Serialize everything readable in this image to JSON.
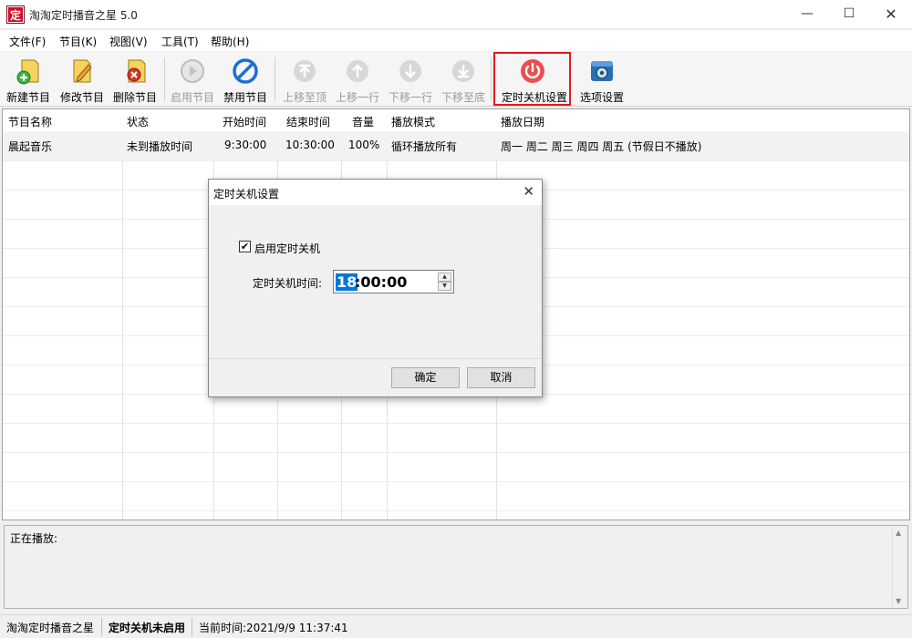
{
  "window": {
    "title": "淘淘定时播音之星 5.0",
    "app_icon_char": "定",
    "controls": {
      "minimize": "—",
      "maximize": "☐",
      "close": "✕"
    }
  },
  "menu": [
    "文件(F)",
    "节目(K)",
    "视图(V)",
    "工具(T)",
    "帮助(H)"
  ],
  "toolbar": [
    {
      "label": "新建节目",
      "icon": "new-program-icon",
      "enabled": true
    },
    {
      "label": "修改节目",
      "icon": "edit-program-icon",
      "enabled": true
    },
    {
      "label": "删除节目",
      "icon": "delete-program-icon",
      "enabled": true
    },
    {
      "label": "启用节目",
      "icon": "play-icon",
      "enabled": false
    },
    {
      "label": "禁用节目",
      "icon": "disable-icon",
      "enabled": true
    },
    {
      "label": "上移至顶",
      "icon": "move-top-icon",
      "enabled": false
    },
    {
      "label": "上移一行",
      "icon": "move-up-icon",
      "enabled": false
    },
    {
      "label": "下移一行",
      "icon": "move-down-icon",
      "enabled": false
    },
    {
      "label": "下移至底",
      "icon": "move-bottom-icon",
      "enabled": false
    },
    {
      "label": "定时关机设置",
      "icon": "power-icon",
      "enabled": true,
      "highlighted": true
    },
    {
      "label": "选项设置",
      "icon": "options-icon",
      "enabled": true
    }
  ],
  "table": {
    "columns": [
      "节目名称",
      "状态",
      "开始时间",
      "结束时间",
      "音量",
      "播放模式",
      "播放日期"
    ],
    "rows": [
      [
        "晨起音乐",
        "未到播放时间",
        "9:30:00",
        "10:30:00",
        "100%",
        "循环播放所有",
        "周一 周二 周三 周四 周五 (节假日不播放)"
      ]
    ]
  },
  "dialog": {
    "title": "定时关机设置",
    "close": "✕",
    "checkbox_label": "启用定时关机",
    "checkbox_checked": true,
    "checkbox_mark": "✔",
    "time_label": "定时关机时间:",
    "time_hours": "18",
    "time_rest": ":00:00",
    "spin_up": "▲",
    "spin_down": "▼",
    "ok": "确定",
    "cancel": "取消"
  },
  "now_playing": {
    "label": "正在播放:",
    "scroll_up": "▲",
    "scroll_down": "▼"
  },
  "status_bar": {
    "app_name": "淘淘定时播音之星",
    "shutdown_status": "定时关机未启用",
    "current_time": "当前时间:2021/9/9 11:37:41"
  },
  "colors": {
    "highlight_border": "#e0191f",
    "selection": "#0078d7"
  }
}
